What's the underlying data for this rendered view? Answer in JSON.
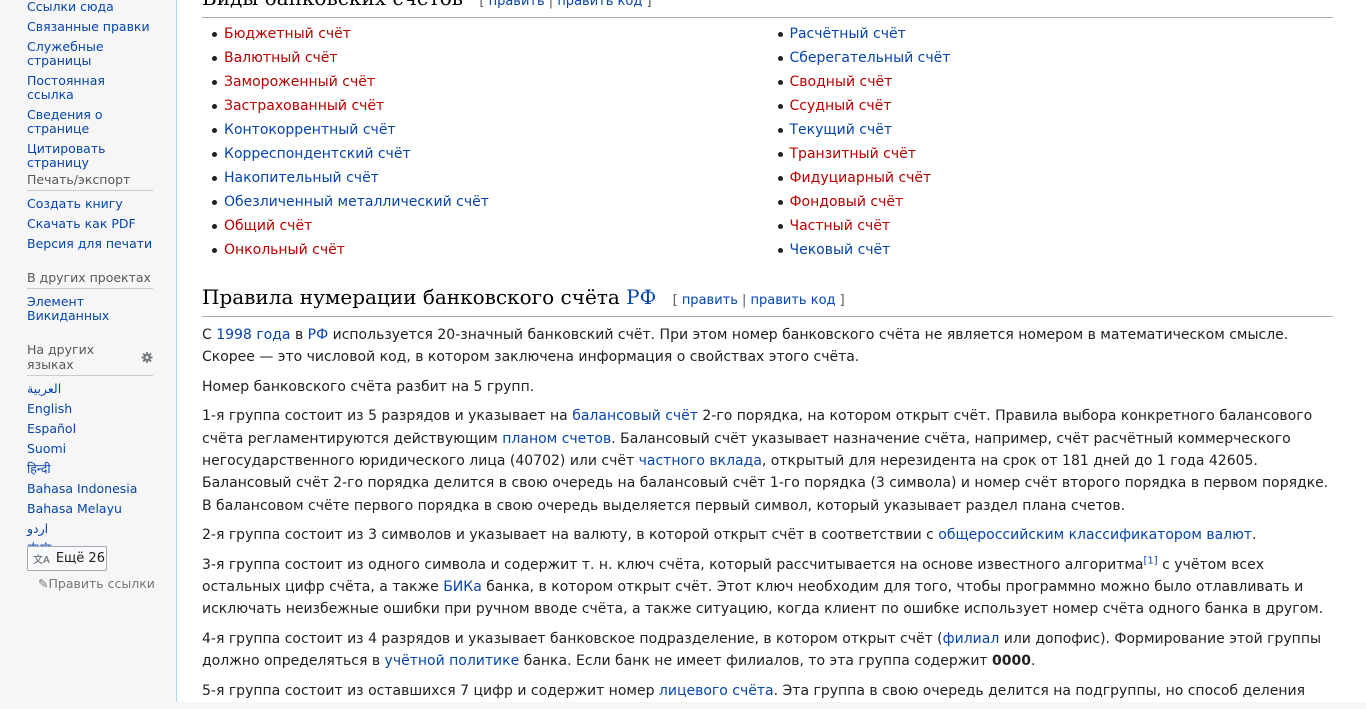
{
  "sidebar": {
    "tools_items": [
      "Ссылки сюда",
      "Связанные правки",
      "Служебные страницы",
      "Постоянная ссылка",
      "Сведения о странице",
      "Цитировать страницу"
    ],
    "print_heading": "Печать/экспорт",
    "print_items": [
      "Создать книгу",
      "Скачать как PDF",
      "Версия для печати"
    ],
    "projects_heading": "В других проектах",
    "projects_items": [
      "Элемент Викиданных"
    ],
    "languages_heading": "На других языках",
    "languages": [
      "العربية",
      "English",
      "Español",
      "Suomi",
      "हिन्दी",
      "Bahasa Indonesia",
      "Bahasa Melayu",
      "اردو",
      "中文"
    ],
    "more_button": "Ещё 26",
    "edit_links": "Править ссылки"
  },
  "section1": {
    "title": "Виды банковских счетов",
    "edit_links": [
      "править",
      "править код"
    ],
    "left_items": [
      {
        "text": "Бюджетный счёт",
        "red": true
      },
      {
        "text": "Валютный счёт",
        "red": true
      },
      {
        "text": "Замороженный счёт",
        "red": true
      },
      {
        "text": "Застрахованный счёт",
        "red": true
      },
      {
        "text": "Контокоррентный счёт",
        "red": false
      },
      {
        "text": "Корреспондентский счёт",
        "red": false
      },
      {
        "text": "Накопительный счёт",
        "red": false
      },
      {
        "text": "Обезличенный металлический счёт",
        "red": false
      },
      {
        "text": "Общий счёт",
        "red": true
      },
      {
        "text": "Онкольный счёт",
        "red": true
      }
    ],
    "right_items": [
      {
        "text": "Расчётный счёт",
        "red": false
      },
      {
        "text": "Сберегательный счёт",
        "red": false
      },
      {
        "text": "Сводный счёт",
        "red": true
      },
      {
        "text": "Ссудный счёт",
        "red": true
      },
      {
        "text": "Текущий счёт",
        "red": false
      },
      {
        "text": "Транзитный счёт",
        "red": true
      },
      {
        "text": "Фидуциарный счёт",
        "red": true
      },
      {
        "text": "Фондовый счёт",
        "red": true
      },
      {
        "text": "Частный счёт",
        "red": true
      },
      {
        "text": "Чековый счёт",
        "red": false
      }
    ]
  },
  "section2": {
    "title": "Правила нумерации банковского счёта",
    "title_link": "РФ",
    "edit_links": [
      "править",
      "править код"
    ],
    "paragraphs": [
      [
        [
          "С ",
          0
        ],
        [
          "1998 года",
          1
        ],
        [
          " в ",
          0
        ],
        [
          "РФ",
          1
        ],
        [
          " используется 20-значный банковский счёт. При этом номер банковского счёта не является номером в математическом смысле. Скорее — это числовой код, в котором заключена информация о свойствах этого счёта.",
          0
        ]
      ],
      [
        [
          "Номер банковского счёта разбит на 5 групп.",
          0
        ]
      ],
      [
        [
          "1-я группа состоит из 5 разрядов и указывает на ",
          0
        ],
        [
          "балансовый счёт",
          1
        ],
        [
          " 2-го порядка, на котором открыт счёт. Правила выбора конкретного балансового счёта регламентируются действующим ",
          0
        ],
        [
          "планом счетов",
          1
        ],
        [
          ". Балансовый счёт указывает назначение счёта, например, счёт расчётный коммерческого негосударственного юридического лица (40702) или счёт ",
          0
        ],
        [
          "частного вклада",
          1
        ],
        [
          ", открытый для нерезидента на срок от 181 дней до 1 года 42605. Балансовый счёт 2-го порядка делится в свою очередь на балансовый счёт 1-го порядка (3 символа) и номер счёт второго порядка в первом порядке. В балансовом счёте первого порядка в свою очередь выделяется первый символ, который указывает раздел плана счетов.",
          0
        ]
      ],
      [
        [
          "2-я группа состоит из 3 символов и указывает на валюту, в которой открыт счёт в соответствии с ",
          0
        ],
        [
          "общероссийским классификатором валют",
          1
        ],
        [
          ".",
          0
        ]
      ],
      [
        [
          "3-я группа состоит из одного символа и содержит т. н. ключ счёта, который рассчитывается на основе известного алгоритма",
          0
        ],
        [
          "[1]",
          2
        ],
        [
          " с учётом всех остальных цифр счёта, а также ",
          0
        ],
        [
          "БИКа",
          1
        ],
        [
          " банка, в котором открыт счёт. Этот ключ необходим для того, чтобы программно можно было отлавливать и исключать неизбежные ошибки при ручном вводе счёта, а также ситуацию, когда клиент по ошибке использует номер счёта одного банка в другом.",
          0
        ]
      ],
      [
        [
          "4-я группа состоит из 4 разрядов и указывает банковское подразделение, в котором открыт счёт (",
          0
        ],
        [
          "филиал",
          1
        ],
        [
          " или допофис). Формирование этой группы должно определяться в ",
          0
        ],
        [
          "учётной политике",
          1
        ],
        [
          " банка. Если банк не имеет филиалов, то эта группа содержит ",
          0
        ],
        [
          "0000",
          3
        ],
        [
          ".",
          0
        ]
      ],
      [
        [
          "5-я группа состоит из оставшихся 7 цифр и содержит номер ",
          0
        ],
        [
          "лицевого счёта",
          1
        ],
        [
          ". Эта группа в свою очередь делится на подгруппы, но способ деления",
          0
        ]
      ]
    ]
  },
  "colors": {
    "link": "#0645ad",
    "redlink": "#ba0000",
    "text": "#202122",
    "border": "#a7d7f9"
  }
}
